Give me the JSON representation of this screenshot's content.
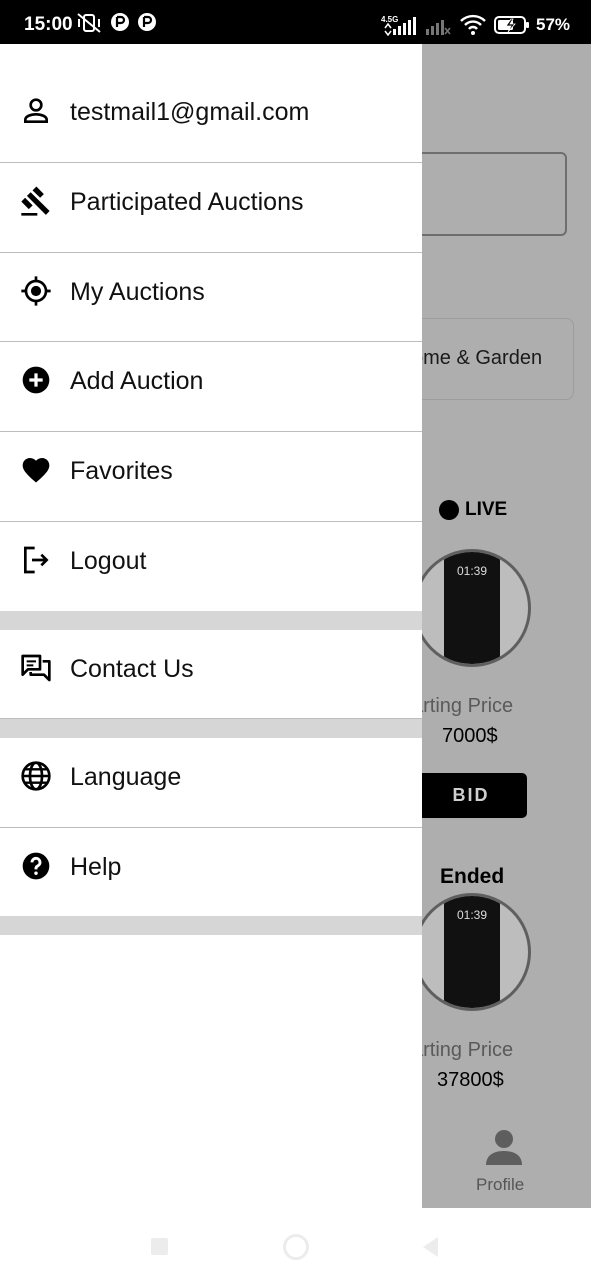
{
  "status_bar": {
    "time": "15:00",
    "network": "4.5G",
    "battery": "57%"
  },
  "background_screen": {
    "category_chip": "ome & Garden",
    "items": [
      {
        "status": "LIVE",
        "phone_time": "01:39",
        "price_label": "arting Price",
        "price": "7000$",
        "button": "BID"
      },
      {
        "status": "Ended",
        "phone_time": "01:39",
        "price_label": "arting Price",
        "price": "37800$"
      }
    ],
    "bottom_nav_profile": "Profile"
  },
  "drawer": {
    "user_email": "testmail1@gmail.com",
    "items": [
      {
        "label": "Participated Auctions",
        "icon": "gavel-icon"
      },
      {
        "label": "My Auctions",
        "icon": "target-icon"
      },
      {
        "label": "Add Auction",
        "icon": "add-circle-icon"
      },
      {
        "label": "Favorites",
        "icon": "heart-icon"
      },
      {
        "label": "Logout",
        "icon": "logout-icon"
      },
      {
        "label": "Contact Us",
        "icon": "chat-icon"
      },
      {
        "label": "Language",
        "icon": "globe-icon"
      },
      {
        "label": "Help",
        "icon": "help-icon"
      }
    ]
  },
  "colors": {
    "scrim": "#aeaeae",
    "drawer_bg": "#ffffff",
    "section_gap": "#d6d6d6",
    "divider": "#bdbdbd"
  }
}
